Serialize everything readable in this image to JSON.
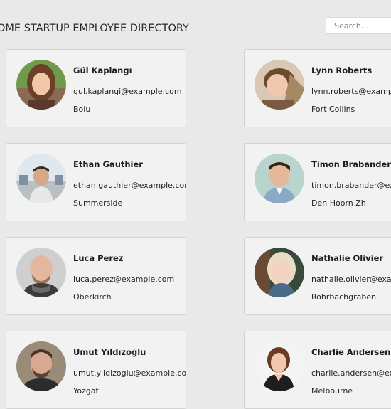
{
  "header": {
    "title": "OME STARTUP EMPLOYEE DIRECTORY",
    "search_placeholder": "Search..."
  },
  "employees": [
    {
      "name": "Gül Kaplangı",
      "email": "gul.kaplangi@example.com",
      "city": "Bolu"
    },
    {
      "name": "Lynn Roberts",
      "email": "lynn.roberts@example.com",
      "city": "Fort Collins"
    },
    {
      "name": "Ethan Gauthier",
      "email": "ethan.gauthier@example.com",
      "city": "Summerside"
    },
    {
      "name": "Timon Brabander",
      "email": "timon.brabander@example.com",
      "city": "Den Hoorn Zh"
    },
    {
      "name": "Luca Perez",
      "email": "luca.perez@example.com",
      "city": "Oberkirch"
    },
    {
      "name": "Nathalie Olivier",
      "email": "nathalie.olivier@example.com",
      "city": "Rohrbachgraben"
    },
    {
      "name": "Umut Yıldızoğlu",
      "email": "umut.yildizoglu@example.com",
      "city": "Yozgat"
    },
    {
      "name": "Charlie Andersen",
      "email": "charlie.andersen@example.com",
      "city": "Melbourne"
    }
  ]
}
